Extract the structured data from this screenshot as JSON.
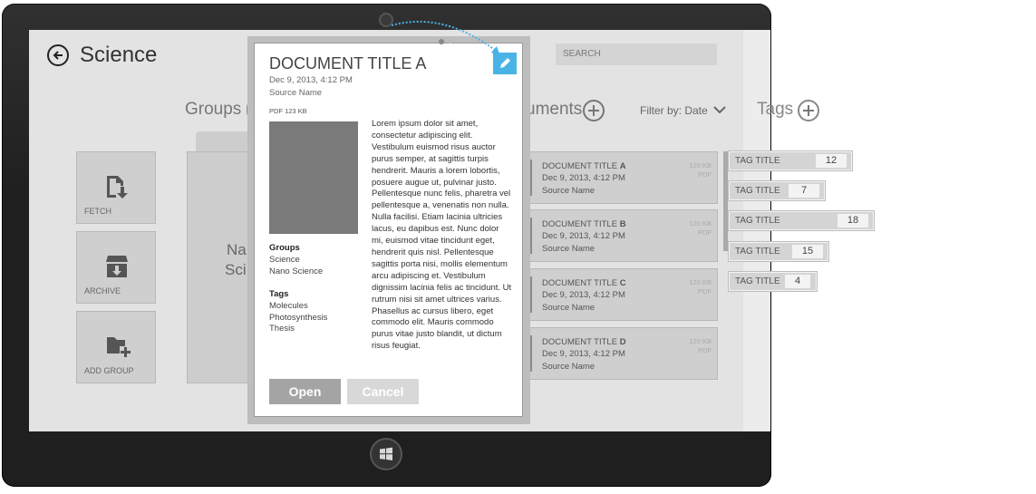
{
  "header": {
    "title": "Science",
    "search_placeholder": "SEARCH"
  },
  "groups": {
    "title": "Groups",
    "tiles": [
      {
        "label": "FETCH",
        "icon": "fetch-icon"
      },
      {
        "label": "ARCHIVE",
        "icon": "archive-icon"
      },
      {
        "label": "ADD GROUP",
        "icon": "add-folder-icon"
      }
    ],
    "folder_text_1": "Na",
    "folder_text_2": "Sci"
  },
  "documents": {
    "title_fragment": "uments",
    "filter_label": "Filter by: Date",
    "items": [
      {
        "prefix": "DOCUMENT TITLE ",
        "letter": "A",
        "date": "Dec 9, 2013, 4:12 PM",
        "source": "Source Name",
        "size": "120 KB",
        "type": "PDF"
      },
      {
        "prefix": "DOCUMENT TITLE ",
        "letter": "B",
        "date": "Dec 9, 2013, 4:12 PM",
        "source": "Source Name",
        "size": "120 KB",
        "type": "PDF"
      },
      {
        "prefix": "DOCUMENT TITLE ",
        "letter": "C",
        "date": "Dec 9, 2013, 4:12 PM",
        "source": "Source Name",
        "size": "120 KB",
        "type": "PDF"
      },
      {
        "prefix": "DOCUMENT TITLE ",
        "letter": "D",
        "date": "Dec 9, 2013, 4:12 PM",
        "source": "Source Name",
        "size": "120 KB",
        "type": "PDF"
      }
    ]
  },
  "tags": {
    "title": "Tags",
    "items": [
      {
        "label": "TAG TITLE",
        "count": "12"
      },
      {
        "label": "TAG TITLE",
        "count": "7"
      },
      {
        "label": "TAG TITLE",
        "count": "18"
      },
      {
        "label": "TAG TITLE",
        "count": "15"
      },
      {
        "label": "TAG TITLE",
        "count": "4"
      }
    ]
  },
  "modal": {
    "title": "DOCUMENT TITLE A",
    "date": "Dec 9, 2013, 4:12 PM",
    "source": "Source Name",
    "file_meta": "PDF   123 KB",
    "body": "Lorem ipsum dolor sit amet, consectetur adipiscing elit. Vestibulum euismod risus auctor purus semper, at sagittis turpis hendrerit. Mauris a lorem lobortis, posuere augue ut, pulvinar justo. Pellentesque nunc felis, pharetra vel pellentesque a, venenatis non nulla. Nulla facilisi. Etiam lacinia ultricies lacus, eu dapibus est. Nunc dolor mi, euismod vitae tincidunt eget, hendrerit quis nisl. Pellentesque sagittis porta nisi, mollis elementum arcu adipiscing et. Vestibulum dignissim lacinia felis ac tincidunt. Ut rutrum nisi sit amet ultrices varius. Phasellus ac cursus libero, eget commodo elit. Mauris commodo purus vitae justo blandit, ut dictum risus feugiat.",
    "groups_heading": "Groups",
    "groups": [
      "Science",
      "Nano Science"
    ],
    "tags_heading": "Tags",
    "tags": [
      "Molecules",
      "Photosynthesis",
      "Thesis"
    ],
    "open_label": "Open",
    "cancel_label": "Cancel"
  },
  "colors": {
    "accent": "#4ab3e6",
    "bezel": "#1f1f1f",
    "screen": "#e3e3e3"
  }
}
